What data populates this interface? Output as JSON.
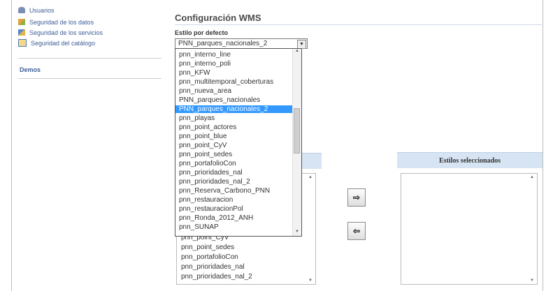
{
  "sidebar": {
    "links": [
      {
        "label": "Usuarios",
        "icon": "users-icon"
      },
      {
        "label": "Seguridad de los datos",
        "icon": "data-security-icon"
      },
      {
        "label": "Seguridad de los servicios",
        "icon": "services-security-icon"
      },
      {
        "label": "Seguridad del catálogo",
        "icon": "catalog-icon"
      }
    ],
    "demos_label": "Demos"
  },
  "main": {
    "title": "Configuración WMS",
    "default_style_label": "Estilo por defecto",
    "default_style_value": "PNN_parques_nacionales_2",
    "dropdown_options": [
      "pnn_interno_line",
      "pnn_interno_poli",
      "pnn_KFW",
      "pnn_multitemporal_coberturas",
      "pnn_nueva_area",
      "PNN_parques_nacionales",
      "PNN_parques_nacionales_2",
      "pnn_playas",
      "pnn_point_actores",
      "pnn_point_blue",
      "pnn_point_CyV",
      "pnn_point_sedes",
      "pnn_portafolioCon",
      "pnn_prioridades_nal",
      "pnn_prioridades_nal_2",
      "pnn_Reserva_Carbono_PNN",
      "pnn_restauracion",
      "pnn_restauracionPol",
      "pnn_Ronda_2012_ANH",
      "pnn_SUNAP"
    ],
    "dropdown_selected_index": 6,
    "available_list_items": [
      "pnn_point_CyV",
      "pnn_point_sedes",
      "pnn_portafolioCon",
      "pnn_prioridades_nal",
      "pnn_prioridades_nal_2"
    ],
    "selected_styles_header": "Estilos seleccionados",
    "add_button_icon": "move-right-icon",
    "remove_button_icon": "move-left-icon"
  }
}
